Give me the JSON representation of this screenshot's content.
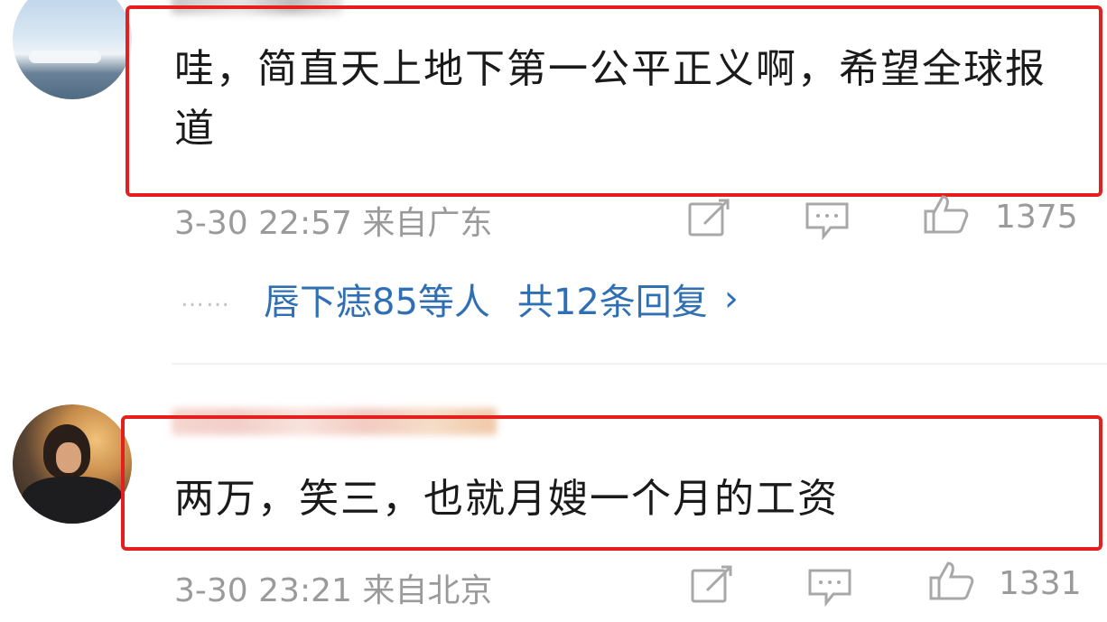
{
  "comments": [
    {
      "text": "哇，简直天上地下第一公平正义啊，希望全球报道",
      "time": "3-30 22:57",
      "location": "来自广东",
      "likes": "1375",
      "reply_summary": {
        "users": "唇下痣85等人",
        "total": "共12条回复",
        "chevron": "›"
      }
    },
    {
      "text": "两万，笑三，也就月嫂一个月的工资",
      "time": "3-30 23:21",
      "location": "来自北京",
      "likes": "1331"
    }
  ],
  "icons": {
    "share": "share-edit-icon",
    "comment": "comment-bubble-icon",
    "like": "thumbs-up-icon"
  },
  "colors": {
    "highlight": "#e51e1e",
    "link": "#2f6fb3",
    "meta": "#9a9a9a"
  }
}
